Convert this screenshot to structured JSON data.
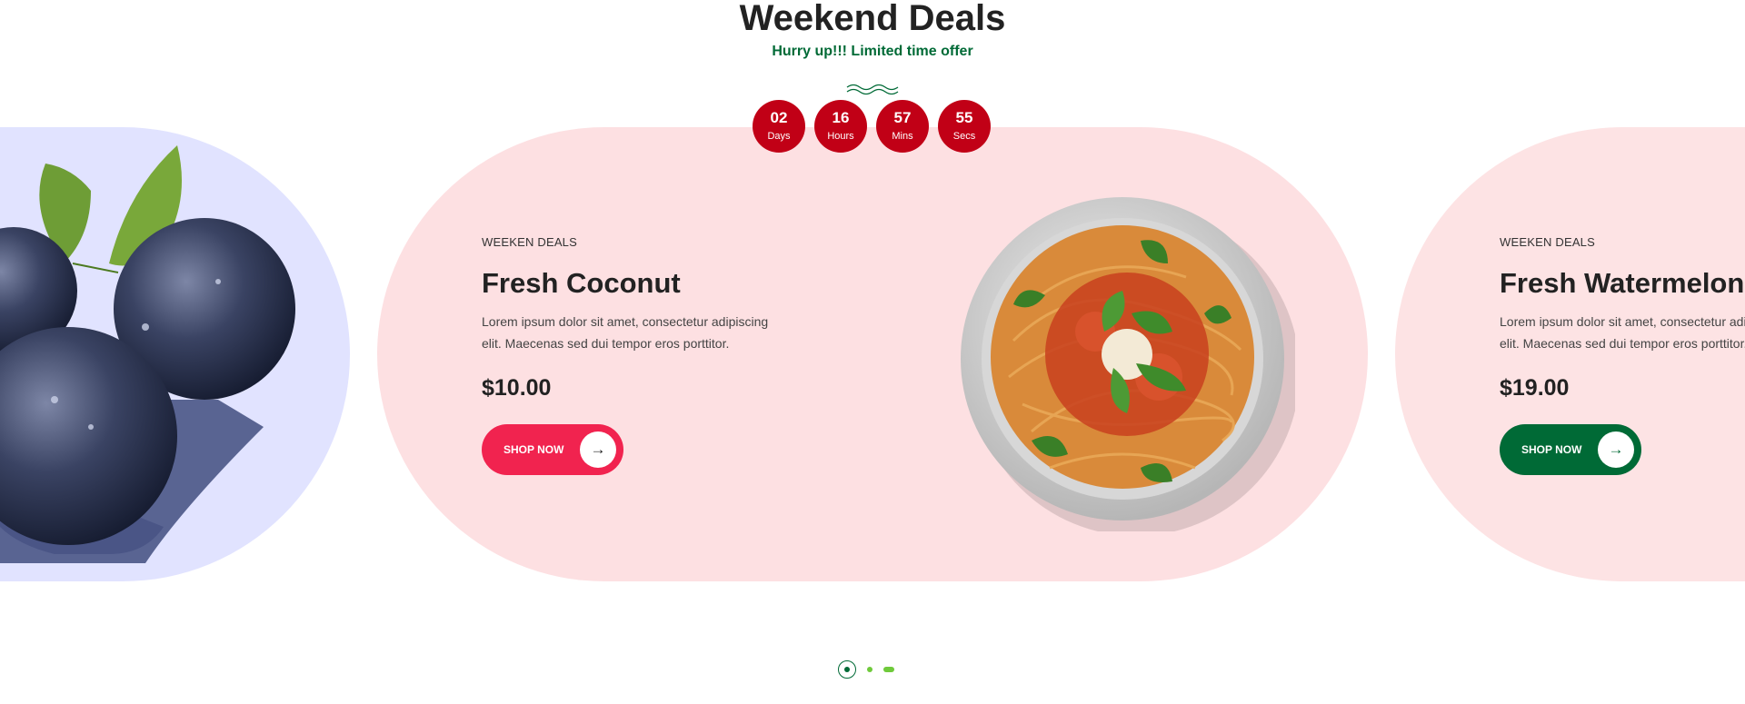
{
  "header": {
    "title": "Weekend Deals",
    "subtitle": "Hurry up!!! Limited time offer"
  },
  "countdown": [
    {
      "value": "02",
      "label": "Days"
    },
    {
      "value": "16",
      "label": "Hours"
    },
    {
      "value": "57",
      "label": "Mins"
    },
    {
      "value": "55",
      "label": "Secs"
    }
  ],
  "slides": {
    "center": {
      "kicker": "WEEKEN DEALS",
      "title": "Fresh Coconut",
      "description": "Lorem ipsum dolor sit amet, consectetur adipiscing elit. Maecenas sed dui tempor eros porttitor.",
      "price": "$10.00",
      "button_label": "SHOP NOW",
      "button_icon": "arrow-right-icon",
      "image": "pasta-plate-image",
      "background_color": "#fde0e2",
      "button_color": "#f1234f"
    },
    "right": {
      "kicker": "WEEKEN DEALS",
      "title": "Fresh Watermelon",
      "description": "Lorem ipsum dolor sit amet, consectetur adipiscing elit. Maecenas sed dui tempor eros porttitor.",
      "price": "$19.00",
      "button_label": "SHOP NOW",
      "button_icon": "arrow-right-icon",
      "background_color": "#fde3e4",
      "button_color": "#006a36"
    },
    "left": {
      "image": "blueberries-image",
      "background_color": "#e1e3ff"
    }
  },
  "pagination": {
    "active_index": 0,
    "count": 3
  },
  "colors": {
    "brand_green": "#006a36",
    "countdown_red": "#c10016",
    "accent_green": "#6fca3b"
  }
}
